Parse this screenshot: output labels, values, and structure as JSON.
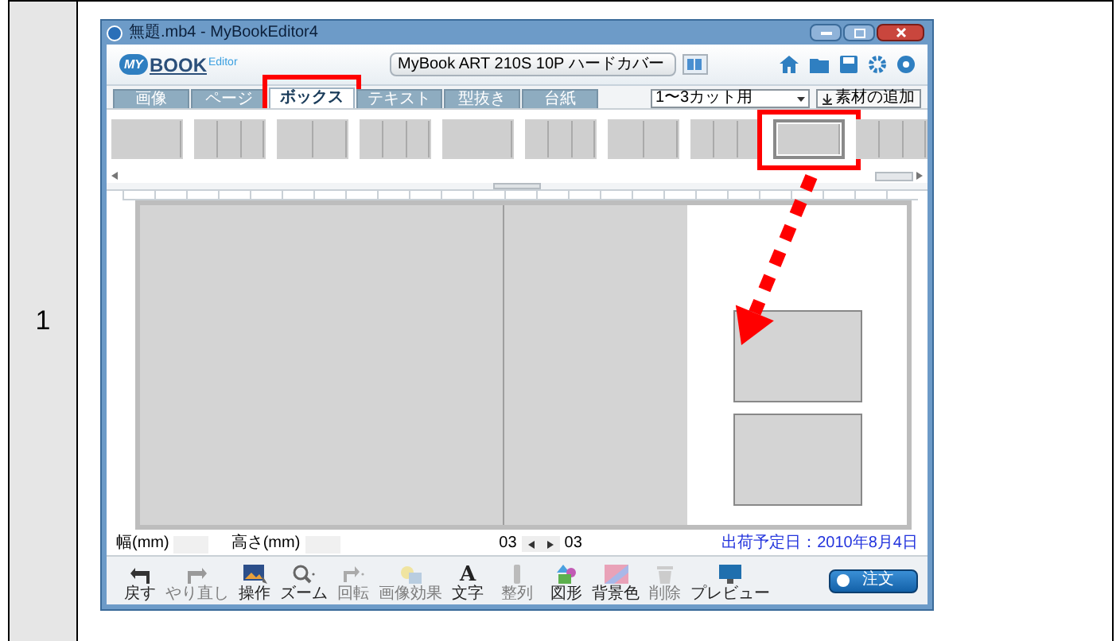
{
  "row": {
    "number": "1"
  },
  "window": {
    "title": "無題.mb4 - MyBookEditor4"
  },
  "header": {
    "logo_badge": "MY",
    "logo": "BOOK",
    "logo_suffix": "Editor",
    "product": "MyBook ART 210S 10P ハードカバー"
  },
  "tabs": [
    {
      "label": "画像",
      "selected": false,
      "highlighted": false
    },
    {
      "label": "ページ",
      "selected": false,
      "highlighted": false
    },
    {
      "label": "ボックス",
      "selected": true,
      "highlighted": true
    },
    {
      "label": "テキスト",
      "selected": false,
      "highlighted": false
    },
    {
      "label": "型抜き",
      "selected": false,
      "highlighted": false
    },
    {
      "label": "台紙",
      "selected": false,
      "highlighted": false
    }
  ],
  "layout_filter": "1〜3カット用",
  "add_material_button": "素材の追加",
  "thumbnails": [
    {
      "highlighted": false
    },
    {
      "highlighted": false
    },
    {
      "highlighted": false
    },
    {
      "highlighted": false
    },
    {
      "highlighted": false
    },
    {
      "highlighted": false
    },
    {
      "highlighted": false
    },
    {
      "highlighted": false
    },
    {
      "highlighted": true
    },
    {
      "highlighted": false
    }
  ],
  "status_bar": {
    "width_label": "幅(mm)",
    "height_label": "高さ(mm)",
    "page_from": "03",
    "page_to": "03",
    "ship_date": "出荷予定日：2010年8月4日"
  },
  "toolbar": [
    {
      "kind": "undo",
      "label": "戻す",
      "disabled": false
    },
    {
      "kind": "redo",
      "label": "やり直し",
      "disabled": true
    },
    {
      "kind": "image",
      "label": "操作",
      "disabled": false
    },
    {
      "kind": "zoom",
      "label": "ズーム",
      "disabled": false
    },
    {
      "kind": "rotate",
      "label": "回転",
      "disabled": true
    },
    {
      "kind": "effect",
      "label": "画像効果",
      "disabled": true
    },
    {
      "kind": "text",
      "glyph": "A",
      "label": "文字",
      "disabled": false
    },
    {
      "kind": "bar",
      "label": "整列",
      "disabled": true
    },
    {
      "kind": "shapes",
      "label": "図形",
      "disabled": false
    },
    {
      "kind": "background",
      "label": "背景色",
      "disabled": false
    },
    {
      "kind": "trash",
      "label": "削除",
      "disabled": true
    },
    {
      "kind": "preview",
      "label": "プレビュー",
      "disabled": false
    }
  ],
  "order_button": "注文"
}
